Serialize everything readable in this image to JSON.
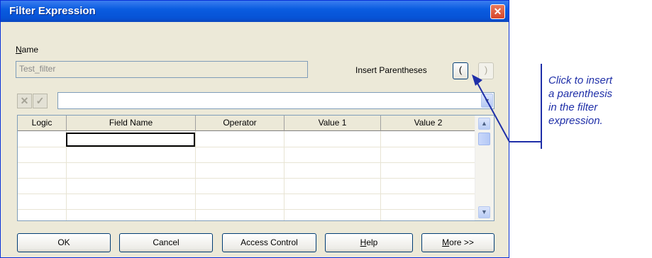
{
  "window": {
    "title": "Filter Expression",
    "close_glyph": "✕"
  },
  "name": {
    "label_accel": "N",
    "label_rest": "ame",
    "value": "Test_filter"
  },
  "parentheses": {
    "label": "Insert Parentheses",
    "open": "(",
    "close": ")"
  },
  "toolbar": {
    "cancel_glyph": "✕",
    "accept_glyph": "✓",
    "expression": ""
  },
  "grid": {
    "columns": [
      "Logic",
      "Field Name",
      "Operator",
      "Value 1",
      "Value 2"
    ],
    "rows": []
  },
  "buttons": {
    "ok": "OK",
    "cancel": "Cancel",
    "access_control": "Access Control",
    "help_accel": "H",
    "help_rest": "elp",
    "more_accel": "M",
    "more_rest": "ore >>"
  },
  "annotation": {
    "lines": [
      "Click to insert",
      "a parenthesis",
      "in the filter",
      "expression."
    ],
    "color": "#1f2fa8"
  },
  "icons": {
    "dropdown": "chevron-down-icon",
    "scroll_up": "scroll-up-icon",
    "scroll_down": "scroll-down-icon"
  }
}
